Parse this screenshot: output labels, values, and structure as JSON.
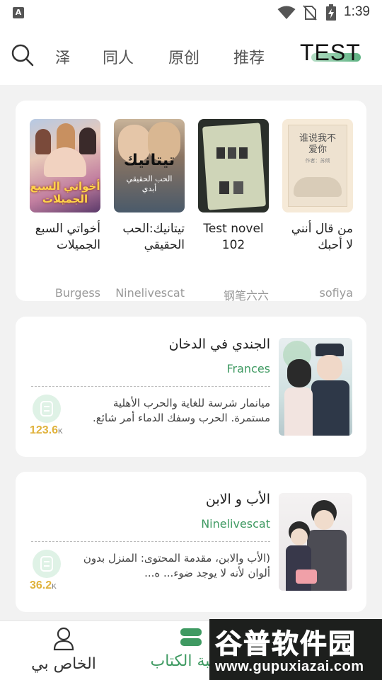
{
  "status_bar": {
    "time": "1:39"
  },
  "top_tabs": {
    "items": [
      "泽",
      "同人",
      "原创",
      "推荐"
    ],
    "active": "TEST"
  },
  "featured_books": [
    {
      "title": "أخواتي السبع الجميلات",
      "author": "Burgess",
      "cover_text": "أخواتي السبع الجميلات"
    },
    {
      "title": "تيتانيك:الحب الحقيقي",
      "author": "Ninelivescat",
      "cover_text": "تيتانيك",
      "cover_subtext": "الحب الحقيقي أبدي"
    },
    {
      "title": "Test novel 102",
      "author": "钢笔六六"
    },
    {
      "title": "من قال أنني لا أحبك",
      "author": "sofiya",
      "cover_text": "谁说我不爱你",
      "cover_subtext": "作者：苏倾"
    }
  ],
  "list_books": [
    {
      "title": "الجندي في الدخان",
      "author": "Frances",
      "description": "ميانمار شرسة للغاية والحرب الأهلية مستمرة. الحرب وسفك الدماء أمر شائع.",
      "count": "123.6",
      "count_unit": "K"
    },
    {
      "title": "الأب و الابن",
      "author": "Ninelivescat",
      "description": "(الأب والابن، مقدمة المحتوى: المنزل بدون ألوان لأنه لا يوجد ضوء... ه...",
      "count": "36.2",
      "count_unit": "K"
    }
  ],
  "bottom_nav": {
    "profile_label": "الخاص بي",
    "shelf_label": "مكتبة الكتاب"
  },
  "watermark": {
    "text": "谷普软件园",
    "url": "www.gupuxiazai.com"
  },
  "colors": {
    "accent": "#3f9a62",
    "count": "#e0b23c"
  }
}
